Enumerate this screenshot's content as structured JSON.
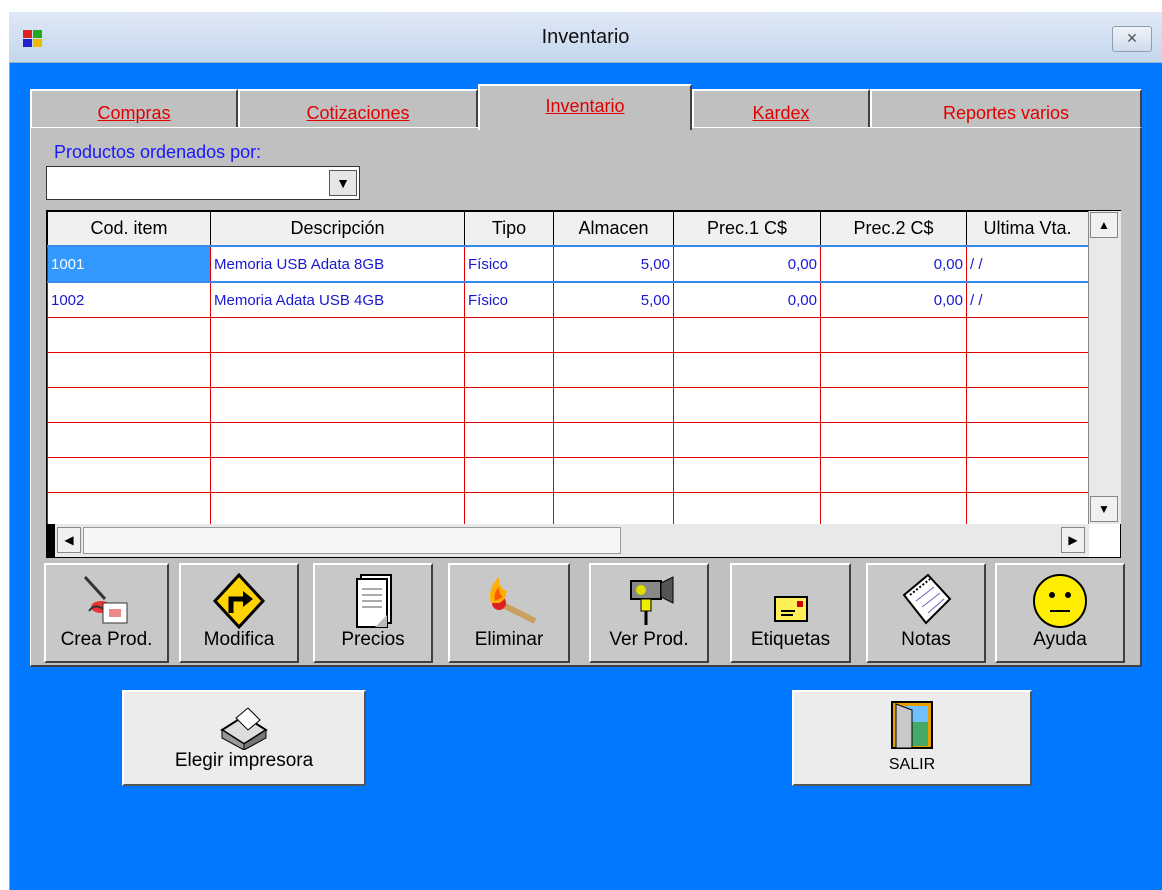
{
  "window": {
    "title": "Inventario",
    "close_glyph": "✕"
  },
  "tabs": [
    {
      "label": "Compras",
      "active": false
    },
    {
      "label": "Cotizaciones",
      "active": false
    },
    {
      "label": "Inventario",
      "active": true
    },
    {
      "label": "Kardex",
      "active": false
    },
    {
      "label": "Reportes varios",
      "active": false
    }
  ],
  "order": {
    "label": "Productos ordenados por:",
    "value": ""
  },
  "grid": {
    "columns": [
      "Cod. item",
      "Descripción",
      "Tipo",
      "Almacen",
      "Prec.1 C$",
      "Prec.2  C$",
      "Ultima Vta."
    ],
    "rows": [
      [
        "1001",
        "Memoria USB Adata 8GB",
        "Físico",
        "5,00",
        "0,00",
        "0,00",
        "/ /"
      ],
      [
        "1002",
        "Memoria Adata USB 4GB",
        "Físico",
        "5,00",
        "0,00",
        "0,00",
        "/ /"
      ]
    ],
    "empty_rows": 6
  },
  "toolbar": [
    {
      "label": "Crea Prod.",
      "icon": "create-product-icon"
    },
    {
      "label": "Modifica",
      "icon": "modify-sign-icon"
    },
    {
      "label": "Precios",
      "icon": "document-icon"
    },
    {
      "label": "Eliminar",
      "icon": "burning-match-icon"
    },
    {
      "label": "Ver Prod.",
      "icon": "video-camera-icon"
    },
    {
      "label": "Etiquetas",
      "icon": "envelope-icon"
    },
    {
      "label": "Notas",
      "icon": "notepad-icon"
    },
    {
      "label": "Ayuda",
      "icon": "smiley-icon"
    }
  ],
  "printer_button": {
    "label": "Elegir impresora",
    "icon": "printer-icon"
  },
  "exit_button": {
    "label": "SALIR",
    "icon": "exit-door-icon"
  },
  "colors": {
    "client_bg": "#0078ff",
    "tab_text": "#e00000",
    "grid_text": "#1818d0",
    "label_blue": "#1818ff"
  }
}
